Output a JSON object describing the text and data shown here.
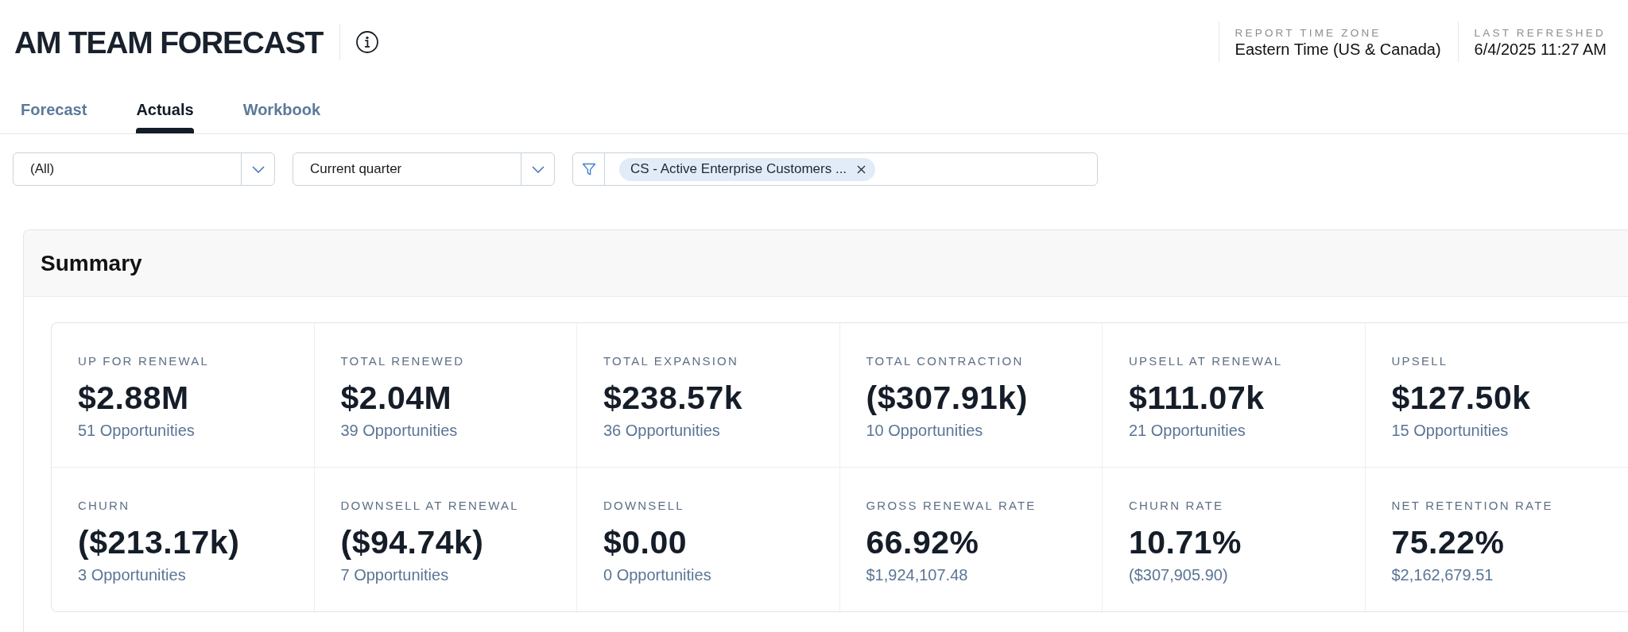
{
  "header": {
    "title": "AM TEAM FORECAST",
    "meta": [
      {
        "label": "REPORT TIME ZONE",
        "value": "Eastern Time (US & Canada)"
      },
      {
        "label": "LAST REFRESHED",
        "value": "6/4/2025 11:27 AM"
      }
    ]
  },
  "tabs": [
    {
      "label": "Forecast",
      "selected": false
    },
    {
      "label": "Actuals",
      "selected": true
    },
    {
      "label": "Workbook",
      "selected": false
    }
  ],
  "filters": {
    "dropdowns": [
      {
        "value": "(All)"
      },
      {
        "value": "Current quarter"
      }
    ],
    "chips": [
      {
        "label": "CS - Active Enterprise Customers ..."
      }
    ]
  },
  "summary": {
    "title": "Summary",
    "rows": [
      [
        {
          "label": "UP FOR RENEWAL",
          "value": "$2.88M",
          "detail": "51 Opportunities"
        },
        {
          "label": "TOTAL RENEWED",
          "value": "$2.04M",
          "detail": "39 Opportunities"
        },
        {
          "label": "TOTAL EXPANSION",
          "value": "$238.57k",
          "detail": "36 Opportunities"
        },
        {
          "label": "TOTAL CONTRACTION",
          "value": "($307.91k)",
          "detail": "10 Opportunities"
        },
        {
          "label": "UPSELL AT RENEWAL",
          "value": "$111.07k",
          "detail": "21 Opportunities"
        },
        {
          "label": "UPSELL",
          "value": "$127.50k",
          "detail": "15 Opportunities"
        }
      ],
      [
        {
          "label": "CHURN",
          "value": "($213.17k)",
          "detail": "3 Opportunities"
        },
        {
          "label": "DOWNSELL AT RENEWAL",
          "value": "($94.74k)",
          "detail": "7 Opportunities"
        },
        {
          "label": "DOWNSELL",
          "value": "$0.00",
          "detail": "0 Opportunities"
        },
        {
          "label": "GROSS RENEWAL RATE",
          "value": "66.92%",
          "detail": "$1,924,107.48"
        },
        {
          "label": "CHURN RATE",
          "value": "10.71%",
          "detail": "($307,905.90)"
        },
        {
          "label": "NET RETENTION RATE",
          "value": "75.22%",
          "detail": "$2,162,679.51"
        }
      ]
    ]
  }
}
